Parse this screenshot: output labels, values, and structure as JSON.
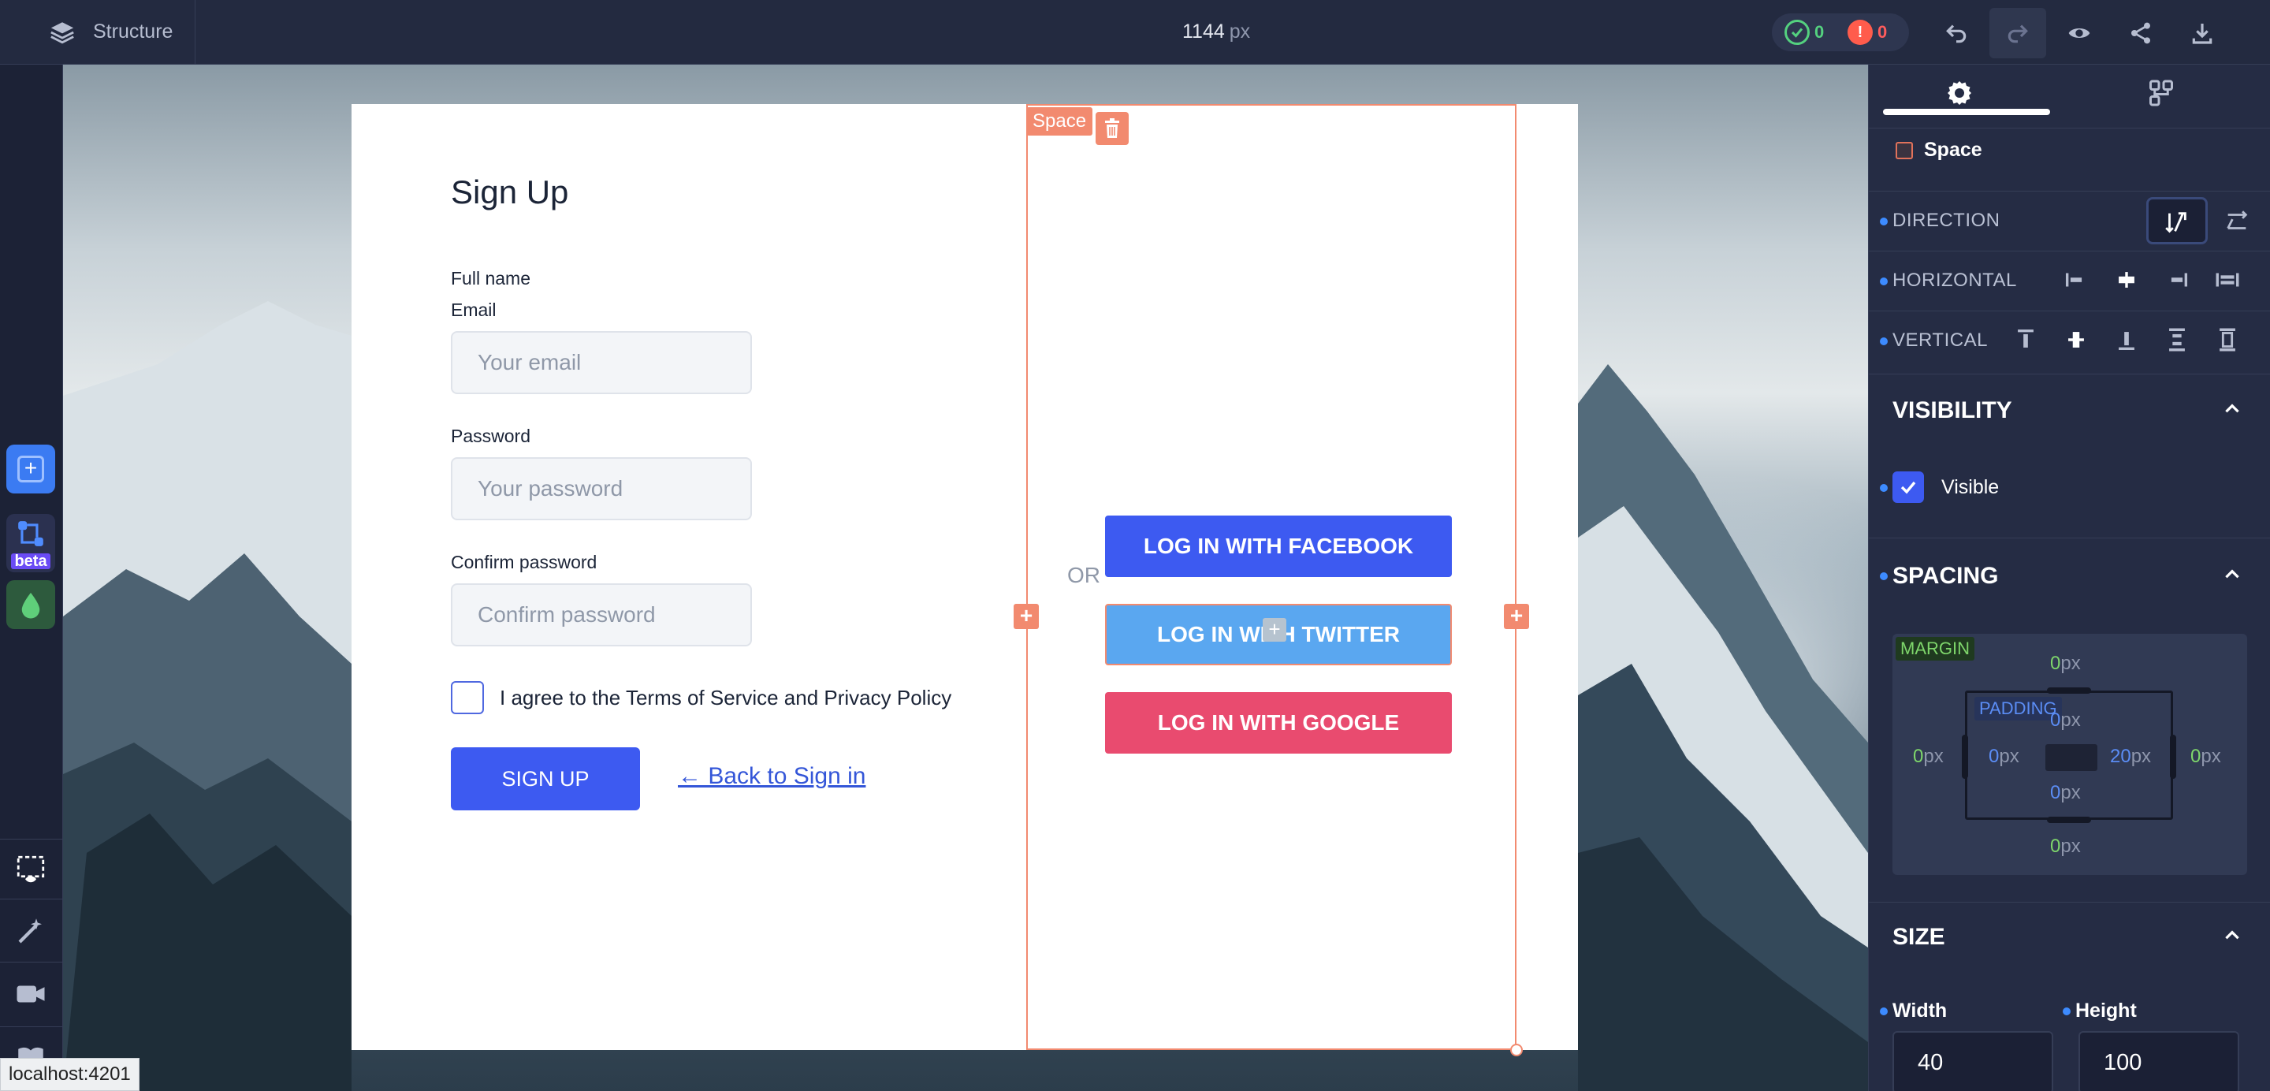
{
  "topbar": {
    "structure_label": "Structure",
    "width_value": "1144",
    "width_unit": "px",
    "ok_count": "0",
    "error_count": "0"
  },
  "left_rail": {
    "beta_label": "beta"
  },
  "form": {
    "title": "Sign Up",
    "fullname_label": "Full name",
    "email_label": "Email",
    "email_placeholder": "Your email",
    "password_label": "Password",
    "password_placeholder": "Your password",
    "confirm_label": "Confirm password",
    "confirm_placeholder": "Confirm password",
    "terms_text": "I agree to the Terms of Service and Privacy Policy",
    "signup_button": "SIGN UP",
    "back_link": "← Back to Sign in"
  },
  "space": {
    "tag_label": "Space",
    "or_text": "OR",
    "facebook_button": "LOG IN WITH FACEBOOK",
    "twitter_button": "LOG IN WITH TWITTER",
    "google_button": "LOG IN WITH GOOGLE"
  },
  "status_bar": {
    "url": "localhost:4201"
  },
  "panel": {
    "component_name": "Space",
    "direction_label": "DIRECTION",
    "horizontal_label": "HORIZONTAL",
    "vertical_label": "VERTICAL",
    "visibility_title": "VISIBILITY",
    "visible_label": "Visible",
    "spacing_title": "SPACING",
    "margin_tag": "MARGIN",
    "padding_tag": "PADDING",
    "margin": {
      "top": "0",
      "right": "0",
      "bottom": "0",
      "left": "0"
    },
    "padding": {
      "top": "0",
      "right": "20",
      "bottom": "0",
      "left": "0"
    },
    "unit": "px",
    "size_title": "SIZE",
    "width_label": "Width",
    "height_label": "Height",
    "width_value": "40",
    "height_value": "100"
  },
  "colors": {
    "accent": "#3d5af1",
    "selection": "#f28a6f",
    "facebook": "#3d5af1",
    "twitter": "#5aa7f0",
    "google": "#e94b6f",
    "success": "#54d17f",
    "error": "#ff5c4c"
  }
}
